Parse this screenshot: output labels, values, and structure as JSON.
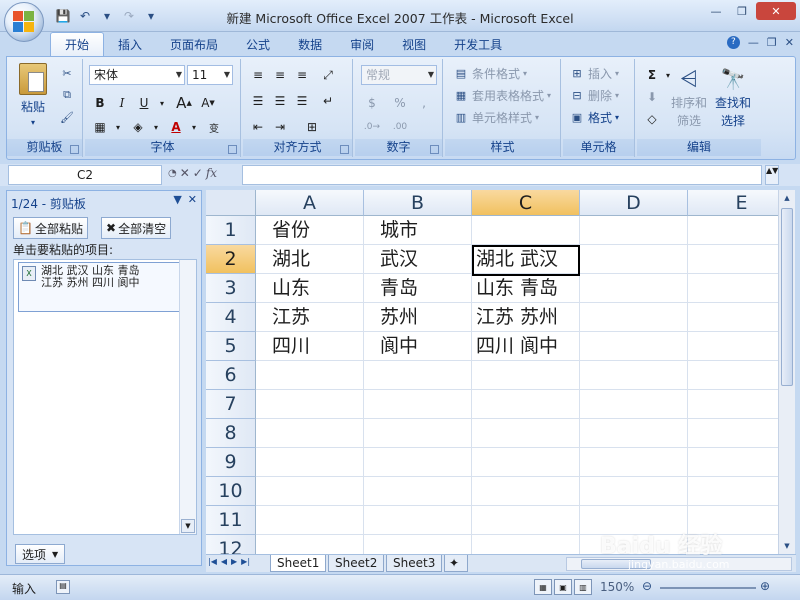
{
  "window": {
    "title": "新建 Microsoft Office Excel 2007 工作表 - Microsoft Excel"
  },
  "tabs": [
    "开始",
    "插入",
    "页面布局",
    "公式",
    "数据",
    "审阅",
    "视图",
    "开发工具"
  ],
  "ribbon": {
    "clipboard": {
      "label": "剪贴板",
      "paste": "粘贴"
    },
    "font": {
      "label": "字体",
      "font_name": "宋体",
      "font_size": "11"
    },
    "alignment": {
      "label": "对齐方式"
    },
    "number": {
      "label": "数字",
      "format": "常规"
    },
    "styles": {
      "label": "样式",
      "conditional": "条件格式",
      "table": "套用表格格式",
      "cell": "单元格样式"
    },
    "cells": {
      "label": "单元格",
      "insert": "插入",
      "delete": "删除",
      "format": "格式"
    },
    "editing": {
      "label": "编辑",
      "sort1": "排序和",
      "sort2": "筛选",
      "find1": "查找和",
      "find2": "选择"
    }
  },
  "formula_bar": {
    "name_box": "C2",
    "formula": "",
    "fx": "fx"
  },
  "clipboard_pane": {
    "title": "1/24 - 剪贴板",
    "paste_all": "全部粘贴",
    "clear_all": "全部清空",
    "hint": "单击要粘贴的项目:",
    "item_line1": "湖北 武汉 山东 青岛",
    "item_line2": "江苏 苏州 四川 阆中",
    "options": "选项"
  },
  "sheet": {
    "columns": [
      "A",
      "B",
      "C",
      "D",
      "E"
    ],
    "rows": [
      "1",
      "2",
      "3",
      "4",
      "5",
      "6",
      "7",
      "8",
      "9",
      "10",
      "11",
      "12"
    ],
    "cells": {
      "A1": "省份",
      "B1": "城市",
      "A2": "湖北",
      "B2": "武汉",
      "C2": "湖北 武汉",
      "A3": "山东",
      "B3": "青岛",
      "C3": "山东 青岛",
      "A4": "江苏",
      "B4": "苏州",
      "C4": "江苏 苏州",
      "A5": "四川",
      "B5": "阆中",
      "C5": "四川 阆中"
    },
    "tabs": [
      "Sheet1",
      "Sheet2",
      "Sheet3"
    ]
  },
  "status": {
    "mode": "输入",
    "zoom": "150%"
  },
  "watermark": {
    "brand": "Baidu 经验",
    "url": "jingyan.baidu.com"
  }
}
